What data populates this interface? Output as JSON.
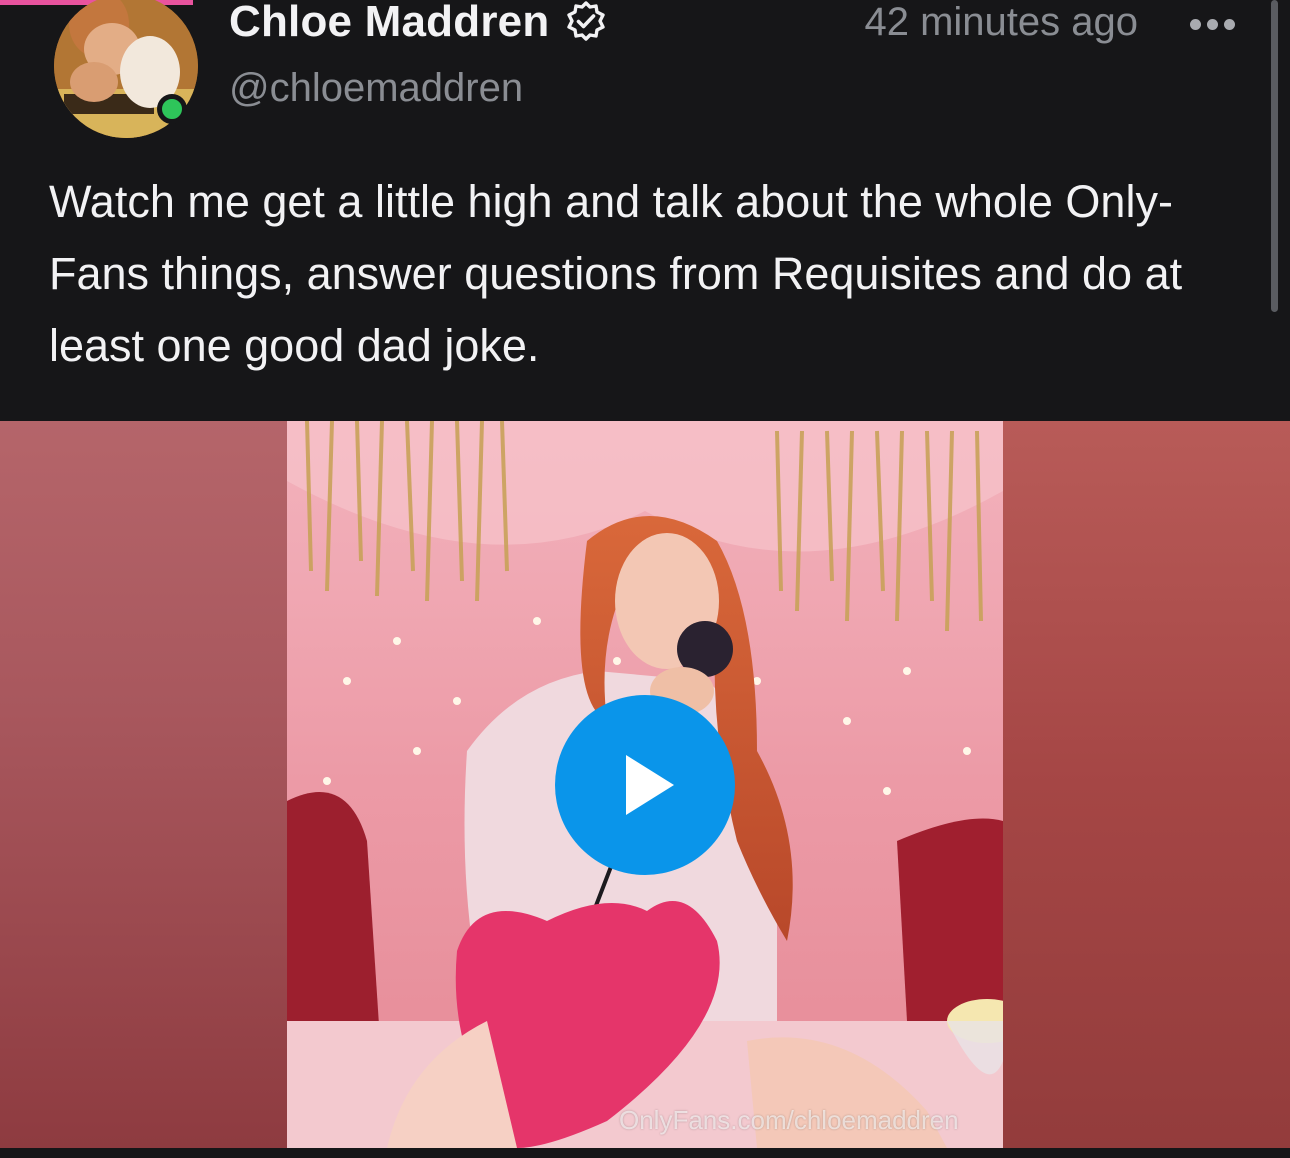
{
  "post": {
    "author": {
      "display_name": "Chloe Maddren",
      "handle": "@chloemaddren",
      "verified_icon": "verified-badge-icon",
      "online": true
    },
    "timestamp": "42 minutes ago",
    "more_icon": "more-horizontal-icon",
    "text": "Watch me get a little high and talk about the whole Only-Fans things, answer questions from Requisites and do at least one good dad joke.",
    "media": {
      "type": "video",
      "play_icon": "play-icon",
      "watermark": "OnlyFans.com/chloemaddren"
    }
  },
  "colors": {
    "background": "#161618",
    "text_primary": "#f2f2f4",
    "text_secondary": "#8a8d93",
    "play_button": "#0a95ea",
    "online_dot": "#2ec55a",
    "accent_pink": "#e8539e"
  }
}
